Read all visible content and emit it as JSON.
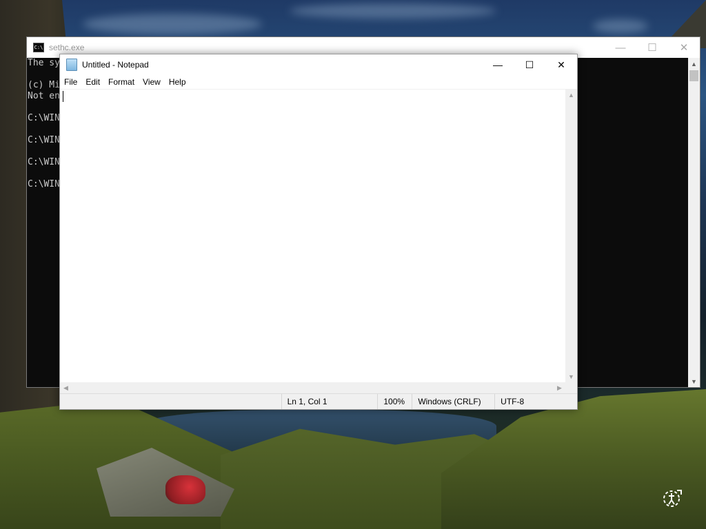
{
  "console": {
    "title": "sethc.exe",
    "lines": [
      "The sy",
      "",
      "(c) Mi",
      "Not en",
      "",
      "C:\\WIN",
      "",
      "C:\\WIN",
      "",
      "C:\\WIN",
      "",
      "C:\\WIN"
    ],
    "controls": {
      "minimize": "—",
      "maximize": "☐",
      "close": "✕"
    }
  },
  "notepad": {
    "title": "Untitled - Notepad",
    "controls": {
      "minimize": "—",
      "maximize": "☐",
      "close": "✕"
    },
    "menu": [
      "File",
      "Edit",
      "Format",
      "View",
      "Help"
    ],
    "content": "",
    "status": {
      "position": "Ln 1, Col 1",
      "zoom": "100%",
      "line_endings": "Windows (CRLF)",
      "encoding": "UTF-8"
    }
  },
  "desktop": {
    "ease_of_access_icon": "ease-of-access-icon"
  }
}
